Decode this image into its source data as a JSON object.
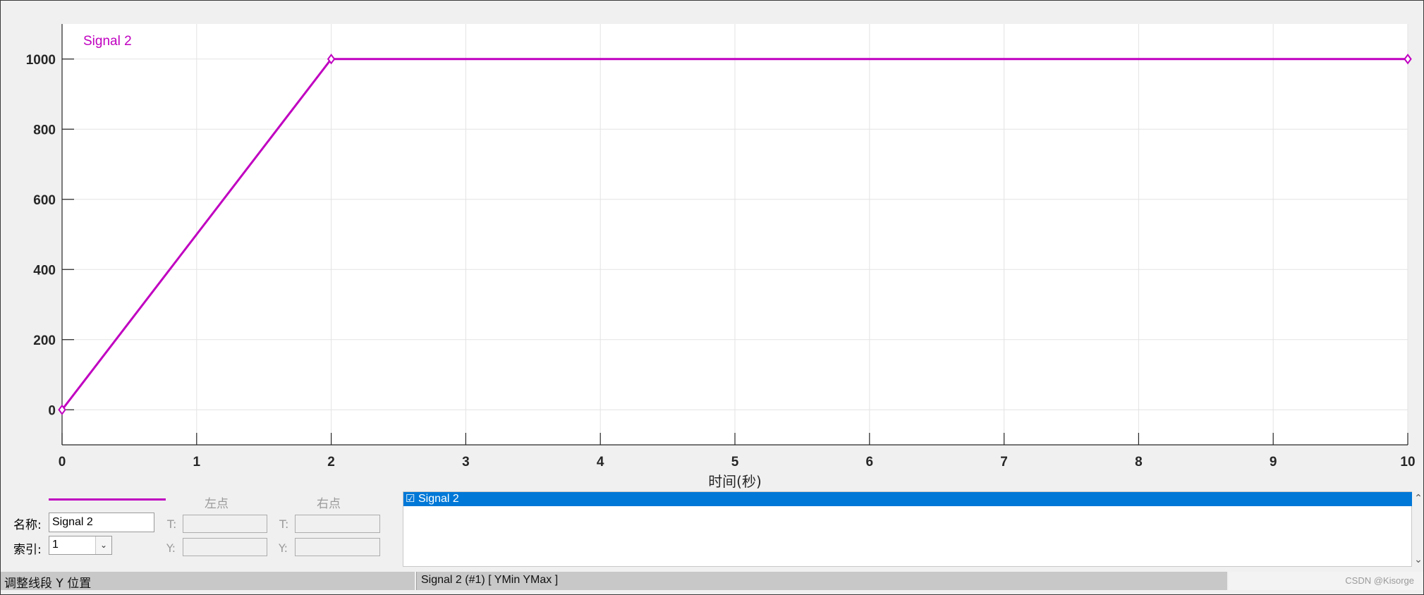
{
  "colors": {
    "signal": "#c000c0",
    "selection": "#0078d7",
    "grid": "#e3e3e3"
  },
  "chart_data": {
    "type": "line",
    "title": "",
    "xlabel": "时间(秒)",
    "ylabel": "",
    "xlim": [
      0,
      10
    ],
    "ylim": [
      -100,
      1100
    ],
    "x_ticks": [
      "0",
      "1",
      "2",
      "3",
      "4",
      "5",
      "6",
      "7",
      "8",
      "9",
      "10"
    ],
    "y_ticks": [
      "0",
      "200",
      "400",
      "600",
      "800",
      "1000"
    ],
    "grid": true,
    "legend_position": "top-left",
    "series": [
      {
        "name": "Signal 2",
        "color": "#c000c0",
        "marker": "diamond",
        "x": [
          0,
          2,
          10
        ],
        "y": [
          0,
          1000,
          1000
        ]
      }
    ]
  },
  "panel": {
    "left_point_header": "左点",
    "right_point_header": "右点",
    "name_label": "名称:",
    "name_value": "Signal 2",
    "index_label": "索引:",
    "index_value": "1",
    "t_label": "T:",
    "y_label": "Y:"
  },
  "signal_list": {
    "rows": [
      {
        "label": "Signal 2",
        "checked": true,
        "checkbox_glyph": "☑"
      }
    ]
  },
  "status_bar": {
    "left_text": "调整线段 Y 位置",
    "mid_text": "Signal 2 (#1)  [ YMin YMax ]",
    "watermark": "CSDN @Kisorge"
  }
}
